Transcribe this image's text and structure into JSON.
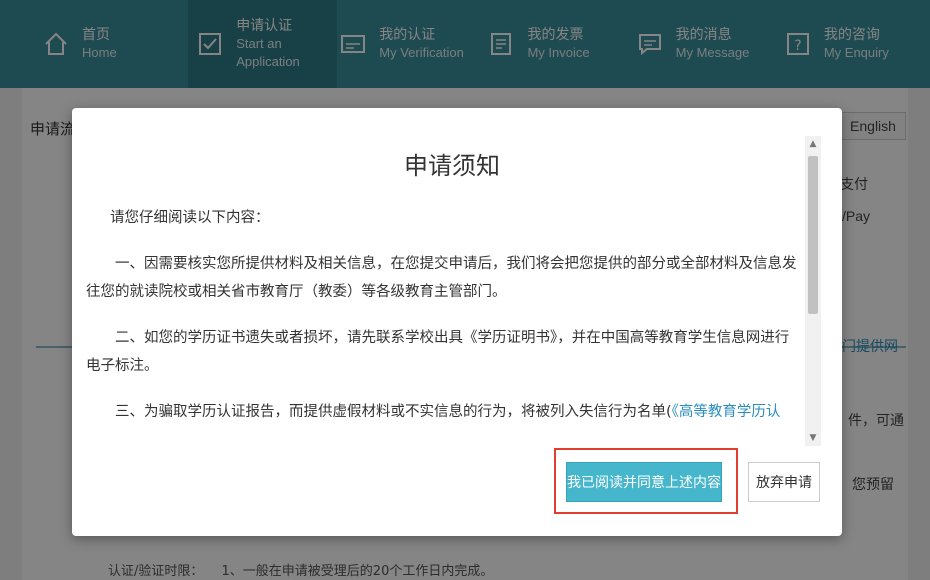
{
  "nav": {
    "items": [
      {
        "cn": "首页",
        "en": "Home",
        "icon": "home-icon"
      },
      {
        "cn": "申请认证",
        "en": "Start an Application",
        "icon": "checkbox-icon",
        "active": true
      },
      {
        "cn": "我的认证",
        "en": "My Verification",
        "icon": "verification-card-icon"
      },
      {
        "cn": "我的发票",
        "en": "My Invoice",
        "icon": "invoice-icon"
      },
      {
        "cn": "我的消息",
        "en": "My Message",
        "icon": "message-icon"
      },
      {
        "cn": "我的咨询",
        "en": "My Enquiry",
        "icon": "enquiry-icon"
      }
    ]
  },
  "background": {
    "title": "申请流",
    "language_button": "English",
    "step_pay_cn": "支付",
    "step_pay_en": "/Pay",
    "frag_provide": "门提供网",
    "frag_ke_tong": "件，可通",
    "frag_yu_liu": "您预留",
    "footer_label": "认证/验证时限：",
    "footer_text": "1、一般在申请被受理后的20个工作日内完成。"
  },
  "modal": {
    "title": "申请须知",
    "intro": "请您仔细阅读以下内容：",
    "paragraph1": "一、因需要核实您所提供材料及相关信息，在您提交申请后，我们将会把您提供的部分或全部材料及信息发往您的就读院校或相关省市教育厅（教委）等各级教育主管部门。",
    "paragraph2": "二、如您的学历证书遗失或者损坏，请先联系学校出具《学历证明书》，并在中国高等教育学生信息网进行电子标注。",
    "paragraph3": "三、为骗取学历认证报告，而提供虚假材料或不实信息的行为，将被列入失信行为名单(",
    "paragraph3_link": "《高等教育学历认",
    "agree_button": "我已阅读并同意上述内容",
    "abandon_button": "放弃申请"
  },
  "colors": {
    "nav_bg": "#3a8e9c",
    "nav_active": "#2f7c89",
    "primary_button": "#46b6cc",
    "highlight": "#e03e2f",
    "link": "#2a8fbd"
  }
}
